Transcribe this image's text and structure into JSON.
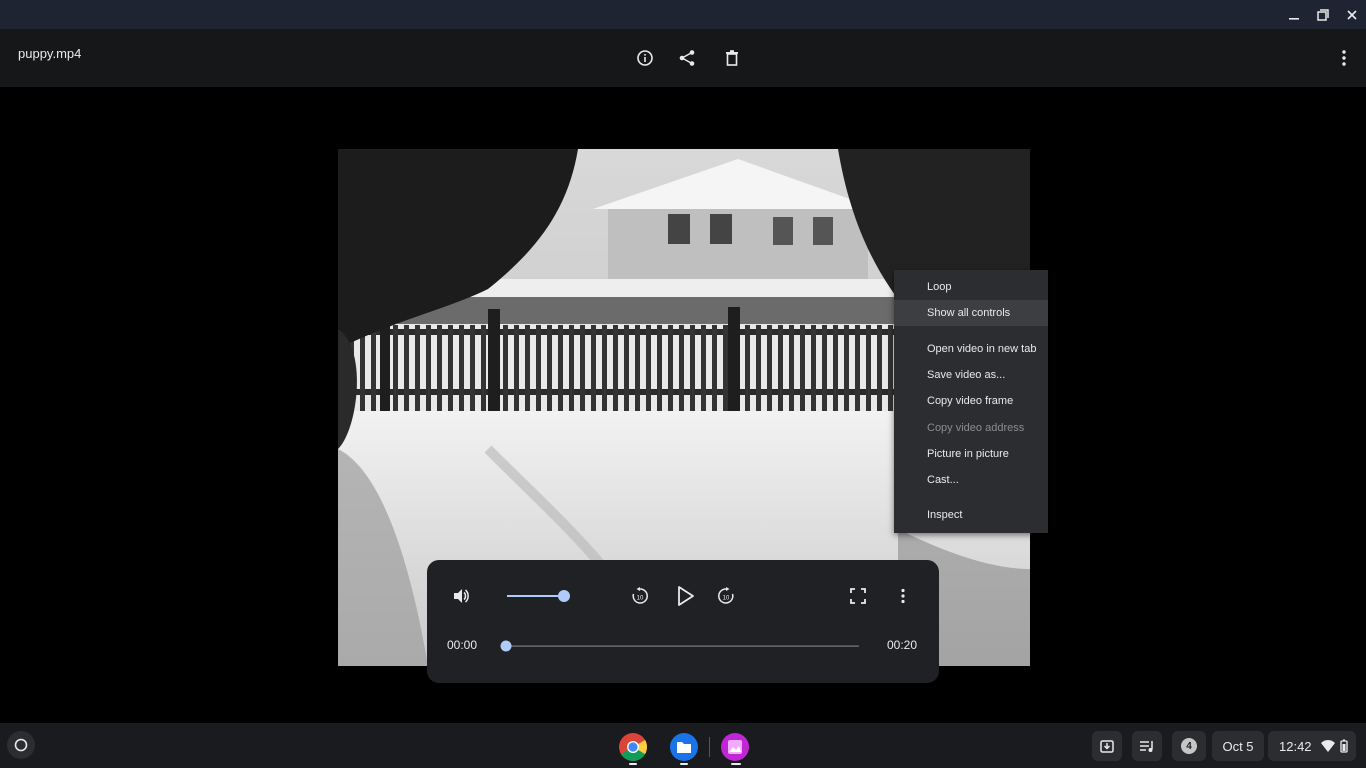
{
  "window": {
    "minimize_icon": "minimize-icon",
    "restore_icon": "restore-icon",
    "close_icon": "close-icon"
  },
  "header": {
    "filename": "puppy.mp4",
    "icons": [
      "info-icon",
      "share-icon",
      "delete-icon",
      "more-vert-icon"
    ]
  },
  "player": {
    "current_time": "00:00",
    "duration": "00:20",
    "progress": 0.0,
    "volume": 1.0
  },
  "context_menu": {
    "items": [
      {
        "label": "Loop",
        "state": "enabled"
      },
      {
        "label": "Show all controls",
        "state": "highlighted"
      },
      {
        "label": "Open video in new tab",
        "state": "enabled"
      },
      {
        "label": "Save video as...",
        "state": "enabled"
      },
      {
        "label": "Copy video frame",
        "state": "enabled"
      },
      {
        "label": "Copy video address",
        "state": "disabled"
      },
      {
        "label": "Picture in picture",
        "state": "enabled"
      },
      {
        "label": "Cast...",
        "state": "enabled"
      },
      {
        "label": "Inspect",
        "state": "enabled"
      }
    ]
  },
  "shelf": {
    "apps": [
      "chrome-icon",
      "files-icon",
      "gallery-icon"
    ],
    "notification_count": "4",
    "date": "Oct 5",
    "time": "12:42"
  },
  "colors": {
    "accent": "#aecbfa",
    "titlebar": "#1f2433",
    "menu_bg": "#2b2d30"
  }
}
